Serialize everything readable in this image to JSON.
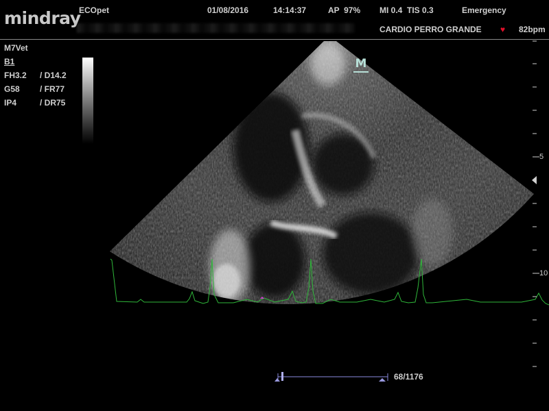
{
  "header": {
    "brand": "mindray",
    "institution": "ECOpet",
    "date": "01/08/2016",
    "time": "14:14:37",
    "ap": "AP  97%",
    "mi_tis": "MI 0.4  TIS 0.3",
    "mode_status": "Emergency",
    "patient": "CARDIO PERRO GRANDE",
    "heart_rate": "82bpm",
    "heart_symbol": "♥"
  },
  "params": {
    "probe": "M7Vet",
    "mode": "B1",
    "row1_left": "FH3.2",
    "row1_right": "/ D14.2",
    "row2_left": "G58",
    "row2_right": "/ FR77",
    "row3_left": "IP4",
    "row3_right": "/ DR75"
  },
  "marker": {
    "label": "M"
  },
  "depth_scale": {
    "labels": [
      "5",
      "10"
    ],
    "focus_icon": "triangle-left-icon"
  },
  "cine": {
    "frame_counter": "68/1176"
  },
  "colors": {
    "background": "#000000",
    "ecg_trace": "#2fb83a",
    "heart": "#e0102a",
    "text": "#d0d0d0",
    "marker": "#b8e0d8",
    "cine_bar": "#8c8ce0"
  }
}
